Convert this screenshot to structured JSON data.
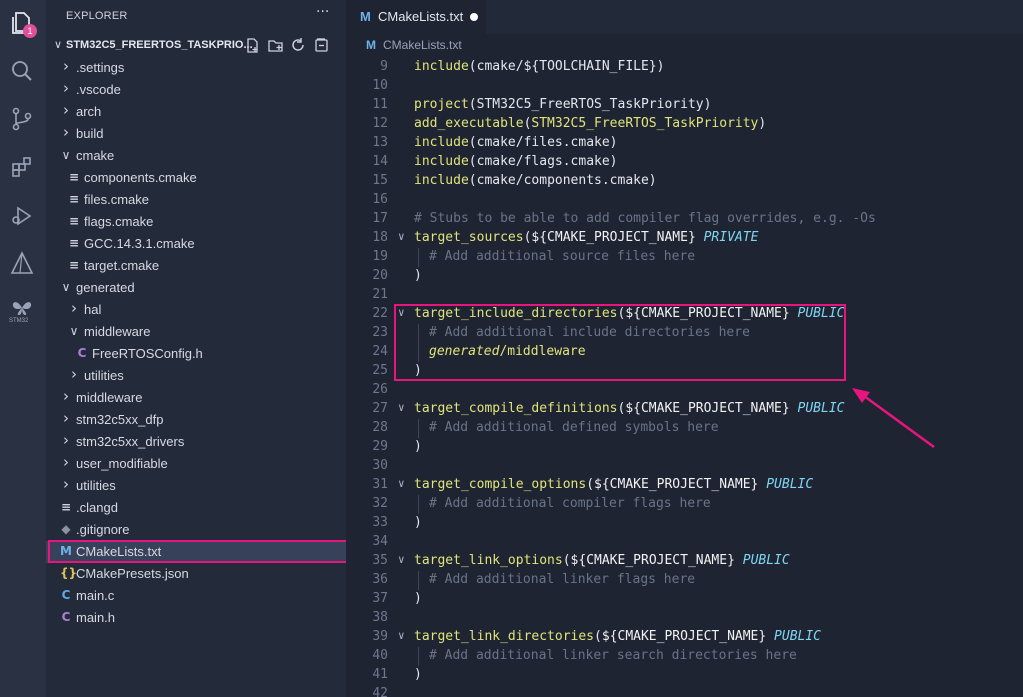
{
  "activity_bar": {
    "explorer_badge": "1",
    "stm32_label": "STM32"
  },
  "sidebar": {
    "header": "EXPLORER",
    "more": "···",
    "project_name": "STM32C5_FREERTOS_TASKPRIO...",
    "items": [
      {
        "label": ".settings",
        "type": "folder",
        "expanded": false
      },
      {
        "label": ".vscode",
        "type": "folder",
        "expanded": false
      },
      {
        "label": "arch",
        "type": "folder",
        "expanded": false
      },
      {
        "label": "build",
        "type": "folder",
        "expanded": false
      },
      {
        "label": "cmake",
        "type": "folder",
        "expanded": true
      },
      {
        "label": "components.cmake",
        "type": "file-text"
      },
      {
        "label": "files.cmake",
        "type": "file-text"
      },
      {
        "label": "flags.cmake",
        "type": "file-text"
      },
      {
        "label": "GCC.14.3.1.cmake",
        "type": "file-text"
      },
      {
        "label": "target.cmake",
        "type": "file-text"
      },
      {
        "label": "generated",
        "type": "folder",
        "expanded": true
      },
      {
        "label": "hal",
        "type": "folder",
        "expanded": false
      },
      {
        "label": "middleware",
        "type": "folder",
        "expanded": true
      },
      {
        "label": "FreeRTOSConfig.h",
        "type": "file-c"
      },
      {
        "label": "utilities",
        "type": "folder",
        "expanded": false
      },
      {
        "label": "middleware",
        "type": "folder",
        "expanded": false
      },
      {
        "label": "stm32c5xx_dfp",
        "type": "folder",
        "expanded": false
      },
      {
        "label": "stm32c5xx_drivers",
        "type": "folder",
        "expanded": false
      },
      {
        "label": "user_modifiable",
        "type": "folder",
        "expanded": false
      },
      {
        "label": "utilities",
        "type": "folder",
        "expanded": false
      },
      {
        "label": ".clangd",
        "type": "file-text"
      },
      {
        "label": ".gitignore",
        "type": "file-git"
      },
      {
        "label": "CMakeLists.txt",
        "type": "file-cmake",
        "selected": true
      },
      {
        "label": "CMakePresets.json",
        "type": "file-json"
      },
      {
        "label": "main.c",
        "type": "file-c-source"
      },
      {
        "label": "main.h",
        "type": "file-c"
      }
    ]
  },
  "editor": {
    "tab_icon": "M",
    "tab_label": "CMakeLists.txt",
    "breadcrumb_icon": "M",
    "breadcrumb": "CMakeLists.txt",
    "lines": [
      {
        "n": "9"
      },
      {
        "n": "10"
      },
      {
        "n": "11"
      },
      {
        "n": "12"
      },
      {
        "n": "13"
      },
      {
        "n": "14"
      },
      {
        "n": "15"
      },
      {
        "n": "16"
      },
      {
        "n": "17"
      },
      {
        "n": "18"
      },
      {
        "n": "19"
      },
      {
        "n": "20"
      },
      {
        "n": "21"
      },
      {
        "n": "22"
      },
      {
        "n": "23"
      },
      {
        "n": "24"
      },
      {
        "n": "25"
      },
      {
        "n": "26"
      },
      {
        "n": "27"
      },
      {
        "n": "28"
      },
      {
        "n": "29"
      },
      {
        "n": "30"
      },
      {
        "n": "31"
      },
      {
        "n": "32"
      },
      {
        "n": "33"
      },
      {
        "n": "34"
      },
      {
        "n": "35"
      },
      {
        "n": "36"
      },
      {
        "n": "37"
      },
      {
        "n": "38"
      },
      {
        "n": "39"
      },
      {
        "n": "40"
      },
      {
        "n": "41"
      },
      {
        "n": "42"
      }
    ],
    "code": {
      "l9_fn": "include",
      "l9_rest": "(cmake/${TOOLCHAIN_FILE})",
      "l11_fn": "project",
      "l11_rest": "(STM32C5_FreeRTOS_TaskPriority)",
      "l12_fn": "add_executable",
      "l12_open": "(",
      "l12_arg": "STM32C5_FreeRTOS_TaskPriority",
      "l12_close": ")",
      "l13_fn": "include",
      "l13_rest": "(cmake/files.cmake)",
      "l14_fn": "include",
      "l14_rest": "(cmake/flags.cmake)",
      "l15_fn": "include",
      "l15_rest": "(cmake/components.cmake)",
      "l17_comment": "# Stubs to be able to add compiler flag overrides, e.g. -Os",
      "l18_fn": "target_sources",
      "l18_open": "(",
      "l18_var": "${CMAKE_PROJECT_NAME}",
      "l18_kw": "PRIVATE",
      "l19_comment": "# Add additional source files here",
      "close_paren": ")",
      "l22_fn": "target_include_directories",
      "l22_open": "(",
      "l22_var": "${CMAKE_PROJECT_NAME}",
      "l22_kw": "PUBLIC",
      "l23_comment": "# Add additional include directories here",
      "l24_a": "generated",
      "l24_b": "/middleware",
      "l27_fn": "target_compile_definitions",
      "l27_open": "(",
      "l27_var": "${CMAKE_PROJECT_NAME}",
      "l27_kw": "PUBLIC",
      "l28_comment": "# Add additional defined symbols here",
      "l31_fn": "target_compile_options",
      "l31_open": "(",
      "l31_var": "${CMAKE_PROJECT_NAME}",
      "l31_kw": "PUBLIC",
      "l32_comment": "# Add additional compiler flags here",
      "l35_fn": "target_link_options",
      "l35_open": "(",
      "l35_var": "${CMAKE_PROJECT_NAME}",
      "l35_kw": "PUBLIC",
      "l36_comment": "# Add additional linker flags here",
      "l39_fn": "target_link_directories",
      "l39_open": "(",
      "l39_var": "${CMAKE_PROJECT_NAME}",
      "l39_kw": "PUBLIC",
      "l40_comment": "# Add additional linker search directories here"
    }
  },
  "colors": {
    "highlight": "#e8157f",
    "background": "#1e2432",
    "sidebar": "#232a3a",
    "activity": "#2a3142"
  }
}
